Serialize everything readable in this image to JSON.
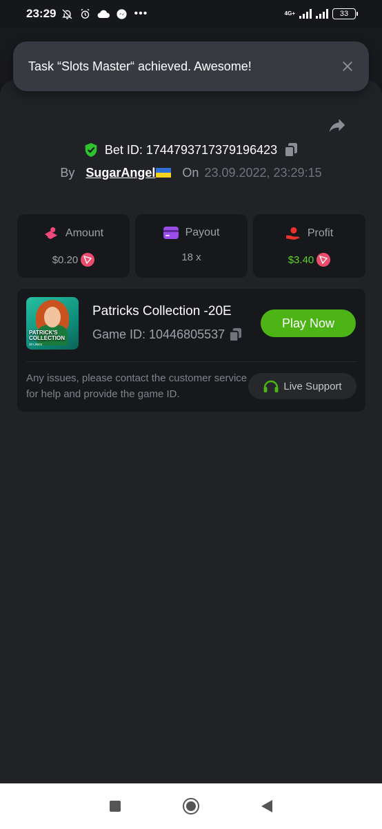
{
  "status_bar": {
    "time": "23:29",
    "network": "4G+",
    "battery": "33"
  },
  "toast": {
    "message": "Task “Slots Master“ achieved. Awesome!"
  },
  "bet": {
    "label": "Bet ID:",
    "id": "1744793717379196423",
    "by_label": "By",
    "user": "SugarAngel",
    "on_label": "On",
    "date": "23.09.2022, 23:29:15"
  },
  "stats": {
    "amount": {
      "label": "Amount",
      "value": "$0.20",
      "icon": "coins-icon"
    },
    "payout": {
      "label": "Payout",
      "value": "18 x",
      "icon": "card-icon"
    },
    "profit": {
      "label": "Profit",
      "value": "$3.40",
      "icon": "hand-coin-icon"
    }
  },
  "game": {
    "thumb_title": "PATRICK'S COLLECTION",
    "thumb_sub": "20 LINES",
    "title": "Patricks Collection -20E",
    "id_label": "Game ID: 10446805537",
    "play_label": "Play Now",
    "help": "Any issues, please contact the customer service for help and provide the game ID.",
    "support_label": "Live Support"
  },
  "colors": {
    "accent_green": "#4cb515",
    "profit_green": "#5cd22b",
    "trx_red": "#ec4d6e",
    "background": "#202226"
  }
}
